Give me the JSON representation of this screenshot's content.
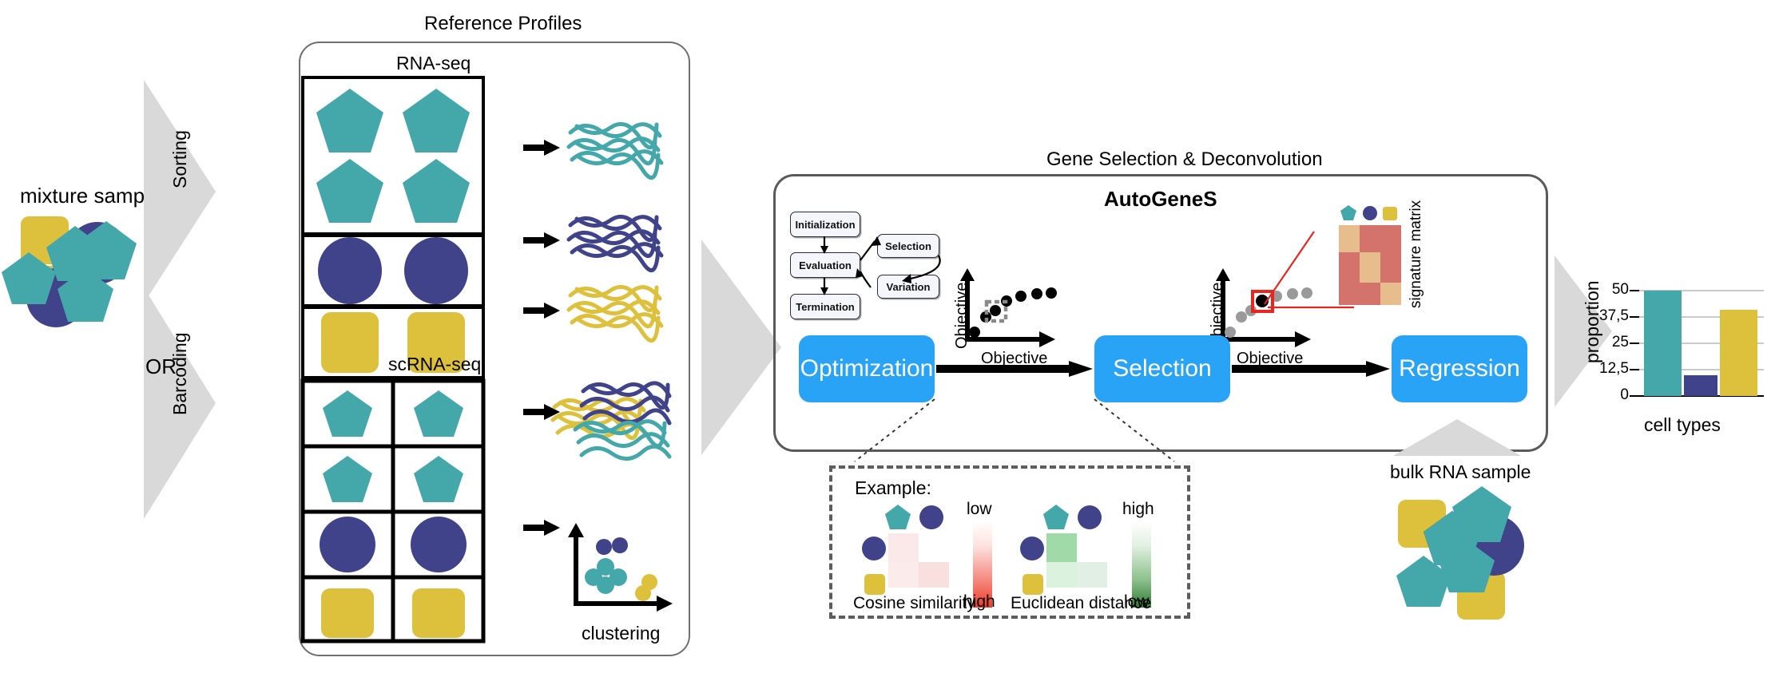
{
  "colors": {
    "teal": "#44a8ab",
    "navy": "#40438a",
    "yellow": "#ddc13c",
    "blue_box": "#29a3f5",
    "gray_arrow": "#d9d9d9",
    "frame_gray": "#6f6f6f",
    "heat_red": "#d4736c",
    "heat_tan": "#e8bd8e",
    "marker_red": "#e8261f"
  },
  "labels": {
    "mixture_sample": "mixture sample",
    "reference_profiles": "Reference Profiles",
    "rna_seq": "RNA-seq",
    "scrna_seq": "scRNA-seq",
    "sorting": "Sorting",
    "barcoding": "Barcoding",
    "or": "OR",
    "clustering": "clustering",
    "gene_selection": "Gene Selection & Deconvolution",
    "autogenes": "AutoGeneS",
    "signature_matrix": "signature matrix",
    "bulk_rna_sample": "bulk RNA sample",
    "objective_y": "Objective",
    "objective_x": "Objective"
  },
  "ga_cycle": {
    "initialization": "Initialization",
    "evaluation": "Evaluation",
    "termination": "Termination",
    "selection": "Selection",
    "variation": "Variation"
  },
  "pipeline": {
    "steps": [
      {
        "label": "Optimization"
      },
      {
        "label": "Selection"
      },
      {
        "label": "Regression"
      }
    ]
  },
  "example_panel": {
    "title": "Example:",
    "cosine": {
      "caption": "Cosine similarity",
      "scale_top": "low",
      "scale_bottom": "high"
    },
    "euclidean": {
      "caption": "Euclidean distance",
      "scale_top": "high",
      "scale_bottom": "low"
    }
  },
  "chart_data": {
    "type": "bar",
    "title": "",
    "xlabel": "cell types",
    "ylabel": "proportion",
    "categories": [
      "teal cell type",
      "navy cell type",
      "yellow cell type"
    ],
    "values": [
      50,
      10,
      41
    ],
    "colors": [
      "#44a8ab",
      "#40438a",
      "#ddc13c"
    ],
    "ylim": [
      0,
      50
    ],
    "yticks": [
      0,
      12.5,
      25,
      37.5,
      50
    ],
    "ytick_labels": [
      "0",
      "12,5",
      "25",
      "37,5",
      "50"
    ],
    "grid": true,
    "legend": false
  },
  "pareto_left": {
    "type": "scatter",
    "xlabel": "Objective",
    "ylabel": "Objective",
    "points": [
      {
        "x": 0.06,
        "y": 0.12
      },
      {
        "x": 0.2,
        "y": 0.4
      },
      {
        "x": 0.3,
        "y": 0.53
      },
      {
        "x": 0.42,
        "y": 0.63
      },
      {
        "x": 0.56,
        "y": 0.7
      },
      {
        "x": 0.72,
        "y": 0.74
      },
      {
        "x": 0.88,
        "y": 0.76
      }
    ],
    "highlight_index": 2,
    "highlight_style": "gray-dashed-square"
  },
  "pareto_right": {
    "type": "scatter",
    "xlabel": "Objective",
    "ylabel": "Objective",
    "points": [
      {
        "x": 0.06,
        "y": 0.12
      },
      {
        "x": 0.2,
        "y": 0.4
      },
      {
        "x": 0.3,
        "y": 0.53
      },
      {
        "x": 0.42,
        "y": 0.63
      },
      {
        "x": 0.56,
        "y": 0.7
      },
      {
        "x": 0.72,
        "y": 0.74
      },
      {
        "x": 0.88,
        "y": 0.76
      }
    ],
    "highlight_index": 3,
    "highlight_style": "red-square"
  },
  "clustering_plot": {
    "type": "scatter",
    "xlabel": "clustering",
    "clusters": [
      {
        "color": "#40438a",
        "points": [
          [
            0.34,
            0.82
          ],
          [
            0.46,
            0.84
          ]
        ]
      },
      {
        "color": "#44a8ab",
        "points": [
          [
            0.32,
            0.5
          ],
          [
            0.22,
            0.39
          ],
          [
            0.33,
            0.33
          ],
          [
            0.43,
            0.4
          ]
        ]
      },
      {
        "color": "#ddc13c",
        "points": [
          [
            0.79,
            0.3
          ],
          [
            0.72,
            0.18
          ]
        ]
      }
    ]
  },
  "signature_matrix": {
    "column_markers": [
      "pentagon-teal",
      "circle-navy",
      "square-yellow"
    ],
    "cells": [
      [
        "tan",
        "red",
        "red"
      ],
      [
        "red",
        "tan",
        "red"
      ],
      [
        "red",
        "red",
        "tan"
      ]
    ]
  }
}
